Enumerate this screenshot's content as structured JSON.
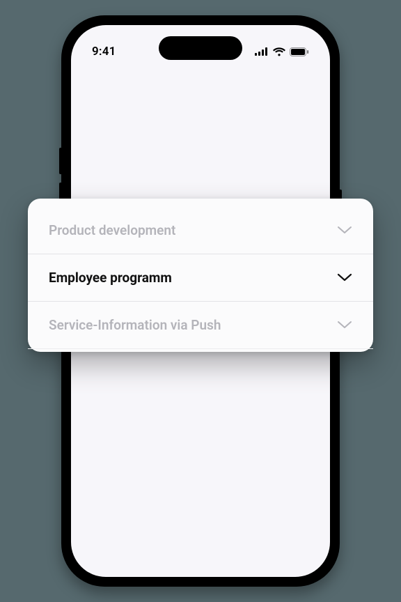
{
  "status": {
    "time": "9:41"
  },
  "card": {
    "items": [
      {
        "label": "Product development",
        "active": false
      },
      {
        "label": "Employee programm",
        "active": true
      },
      {
        "label": "Service-Information via Push",
        "active": false
      }
    ]
  }
}
